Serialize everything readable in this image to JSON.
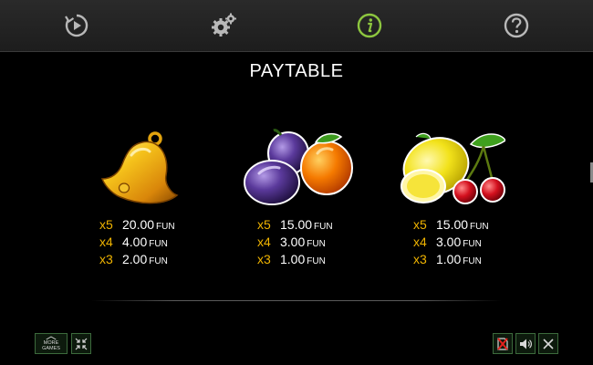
{
  "header": {
    "nav": [
      {
        "id": "replay",
        "icon": "replay-icon"
      },
      {
        "id": "settings",
        "icon": "gear-icon"
      },
      {
        "id": "info",
        "icon": "info-icon",
        "active": true
      },
      {
        "id": "help",
        "icon": "help-icon"
      }
    ],
    "colors": {
      "inactive_icon": "#b8b8b8",
      "active_icon": "#8dc63f"
    }
  },
  "title": "PAYTABLE",
  "symbols": [
    {
      "icon": "bell-icon",
      "payouts": [
        {
          "mult": "x5",
          "amount": "20.00",
          "unit": "FUN"
        },
        {
          "mult": "x4",
          "amount": "4.00",
          "unit": "FUN"
        },
        {
          "mult": "x3",
          "amount": "2.00",
          "unit": "FUN"
        }
      ]
    },
    {
      "icon": "plum-orange-icon",
      "payouts": [
        {
          "mult": "x5",
          "amount": "15.00",
          "unit": "FUN"
        },
        {
          "mult": "x4",
          "amount": "3.00",
          "unit": "FUN"
        },
        {
          "mult": "x3",
          "amount": "1.00",
          "unit": "FUN"
        }
      ]
    },
    {
      "icon": "lemon-cherry-icon",
      "payouts": [
        {
          "mult": "x5",
          "amount": "15.00",
          "unit": "FUN"
        },
        {
          "mult": "x4",
          "amount": "3.00",
          "unit": "FUN"
        },
        {
          "mult": "x3",
          "amount": "1.00",
          "unit": "FUN"
        }
      ]
    }
  ],
  "footer": {
    "more_games_top": "MORE",
    "more_games_bottom": "GAMES",
    "buttons": [
      "more-games-icon",
      "minimize-icon",
      "turbo-off-icon",
      "sound-icon",
      "close-icon"
    ],
    "border_color": "#3c6a3c"
  },
  "colors": {
    "multiplier": "#f0b400",
    "amount": "#ffffff",
    "background": "#000000"
  }
}
